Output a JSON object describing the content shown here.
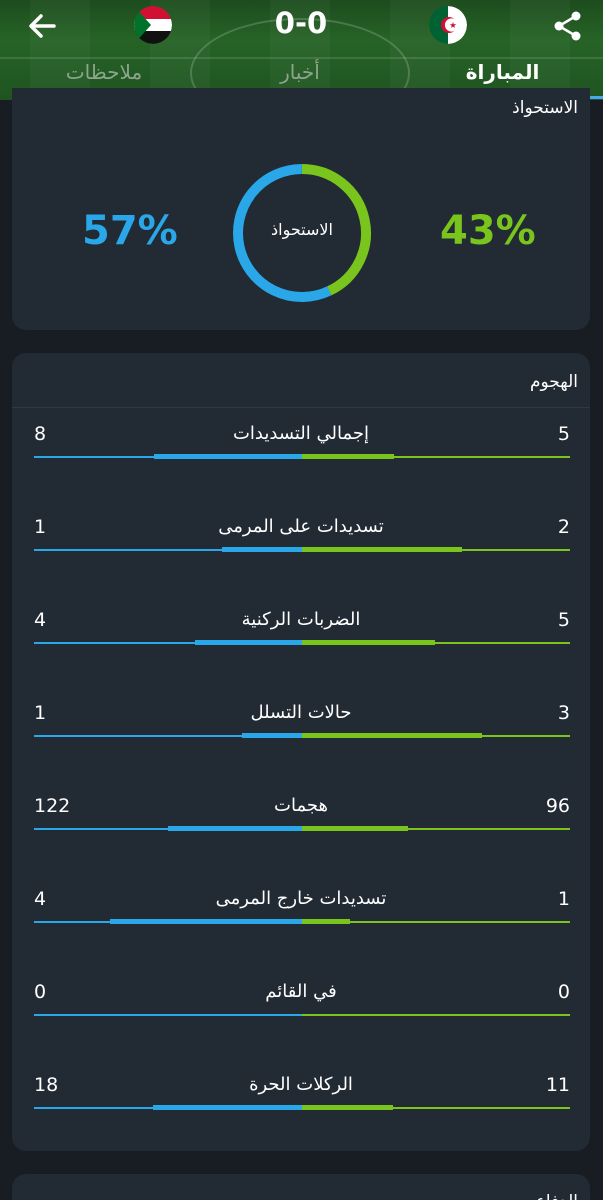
{
  "header": {
    "score": "0-0",
    "away_team_flag": "sudan-flag-icon",
    "home_team_flag": "algeria-flag-icon",
    "back_icon": "arrow-left-icon",
    "share_icon": "share-icon",
    "tabs": [
      {
        "label": "ملاحظات",
        "active": false
      },
      {
        "label": "أخبار",
        "active": false
      },
      {
        "label": "المباراة",
        "active": true
      }
    ]
  },
  "possession": {
    "title": "الاستحواذ",
    "center_label": "الاستحواذ",
    "away_pct": "57%",
    "home_pct": "43%",
    "away_value": 57,
    "home_value": 43
  },
  "attack": {
    "title": "الهجوم",
    "stats": [
      {
        "label": "إجمالي التسديدات",
        "away": "8",
        "home": "5"
      },
      {
        "label": "تسديدات على المرمى",
        "away": "1",
        "home": "2"
      },
      {
        "label": "الضربات الركنية",
        "away": "4",
        "home": "5"
      },
      {
        "label": "حالات التسلل",
        "away": "1",
        "home": "3"
      },
      {
        "label": "هجمات",
        "away": "122",
        "home": "96"
      },
      {
        "label": "تسديدات خارج المرمى",
        "away": "4",
        "home": "1"
      },
      {
        "label": "في القائم",
        "away": "0",
        "home": "0"
      },
      {
        "label": "الركلات الحرة",
        "away": "18",
        "home": "11"
      }
    ]
  },
  "defense": {
    "title": "الدفاع"
  },
  "colors": {
    "away": "#2aa7e8",
    "home": "#79c51e",
    "background": "#181d24",
    "card": "#222a33",
    "tab_active_underline": "#4aa8ea"
  }
}
